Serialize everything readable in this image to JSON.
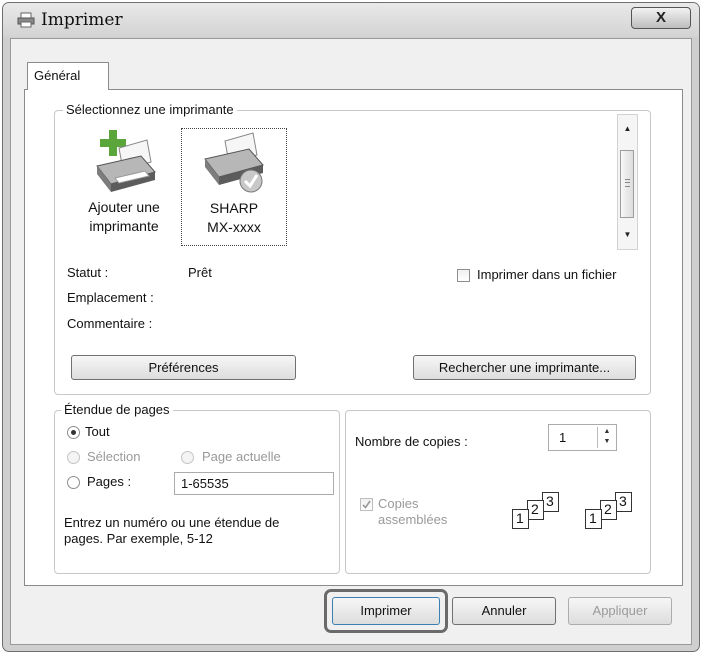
{
  "window": {
    "title": "Imprimer",
    "close_symbol": "X"
  },
  "tabs": [
    {
      "label": "Général"
    }
  ],
  "printer_group": {
    "legend": "Sélectionnez une imprimante",
    "printers": [
      {
        "name_line1": "Ajouter une",
        "name_line2": "imprimante",
        "icon": "add-printer-icon"
      },
      {
        "name_line1": "SHARP",
        "name_line2": "MX-xxxx",
        "icon": "printer-default-icon",
        "selected": true
      }
    ],
    "status_label": "Statut :",
    "status_value": "Prêt",
    "location_label": "Emplacement :",
    "comment_label": "Commentaire :",
    "print_to_file_label": "Imprimer dans un fichier",
    "preferences_button": "Préférences",
    "find_printer_button": "Rechercher une imprimante..."
  },
  "page_range": {
    "legend": "Étendue de pages",
    "all_label": "Tout",
    "selection_label": "Sélection",
    "current_page_label": "Page actuelle",
    "pages_label": "Pages :",
    "pages_value": "1-65535",
    "help_line1": "Entrez un numéro ou une étendue de",
    "help_line2": "pages. Par exemple, 5-12",
    "selected_option": "Tout"
  },
  "copies": {
    "label": "Nombre de copies :",
    "value": "1",
    "collate_line1": "Copies",
    "collate_line2": "assemblées",
    "collate_checked": true,
    "page_numbers": [
      "1",
      "2",
      "3"
    ]
  },
  "footer": {
    "print_button": "Imprimer",
    "cancel_button": "Annuler",
    "apply_button": "Appliquer"
  },
  "colors": {
    "dialog_bg": "#f0f0f0",
    "panel_bg": "#ffffff",
    "disabled_text": "#9a9a9a"
  }
}
